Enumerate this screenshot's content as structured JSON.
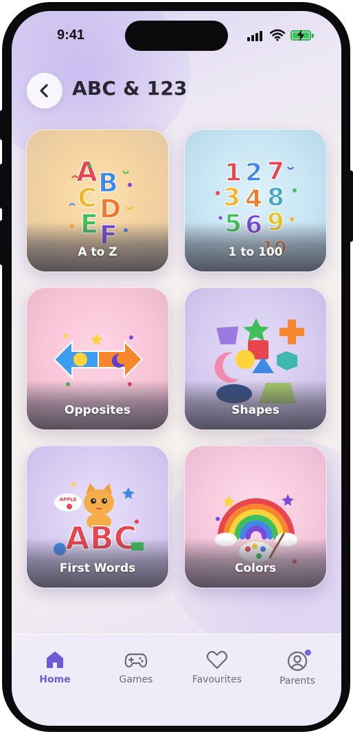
{
  "status_bar": {
    "time": "9:41"
  },
  "header": {
    "title": "ABC & 123",
    "back_icon": "chevron-left-icon"
  },
  "cards": [
    {
      "label": "A to Z"
    },
    {
      "label": "1 to 100"
    },
    {
      "label": "Opposites"
    },
    {
      "label": "Shapes"
    },
    {
      "label": "First Words"
    },
    {
      "label": "Colors"
    }
  ],
  "card_art": {
    "letters": [
      "A",
      "B",
      "C",
      "D",
      "E",
      "F"
    ],
    "numbers": [
      "1",
      "2",
      "7",
      "3",
      "4",
      "8",
      "5",
      "6",
      "9",
      "10"
    ],
    "first_words": {
      "sticker": "APPLE",
      "letters": "ABC"
    }
  },
  "bottom_nav": {
    "items": [
      {
        "label": "Home",
        "icon": "home-icon",
        "active": true
      },
      {
        "label": "Games",
        "icon": "gamepad-icon",
        "active": false
      },
      {
        "label": "Favourites",
        "icon": "heart-icon",
        "active": false
      },
      {
        "label": "Parents",
        "icon": "user-circle-icon",
        "active": false
      }
    ]
  },
  "colors": {
    "accent": "#6f5ad6",
    "title": "#2a2630",
    "battery": "#35c55b"
  }
}
